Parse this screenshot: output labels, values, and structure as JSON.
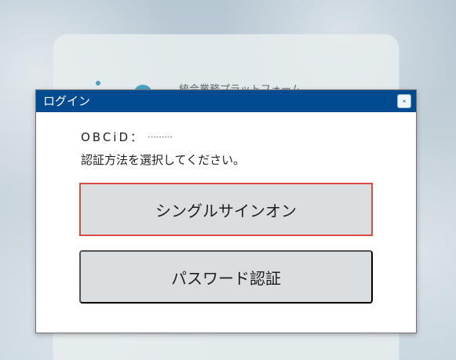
{
  "background": {
    "platform_text": "統合業務プラットフォーム"
  },
  "dialog": {
    "title": "ログイン",
    "close_icon": "close-icon",
    "obc_id_label": "OBCiD：",
    "obc_id_value": "•••••••••",
    "instruction": "認証方法を選択してください。",
    "buttons": {
      "single_sign_on": "シングルサインオン",
      "password_auth": "パスワード認証"
    }
  },
  "colors": {
    "header": "#004a91",
    "button": "#dbdee0",
    "highlight": "#d94b43"
  }
}
